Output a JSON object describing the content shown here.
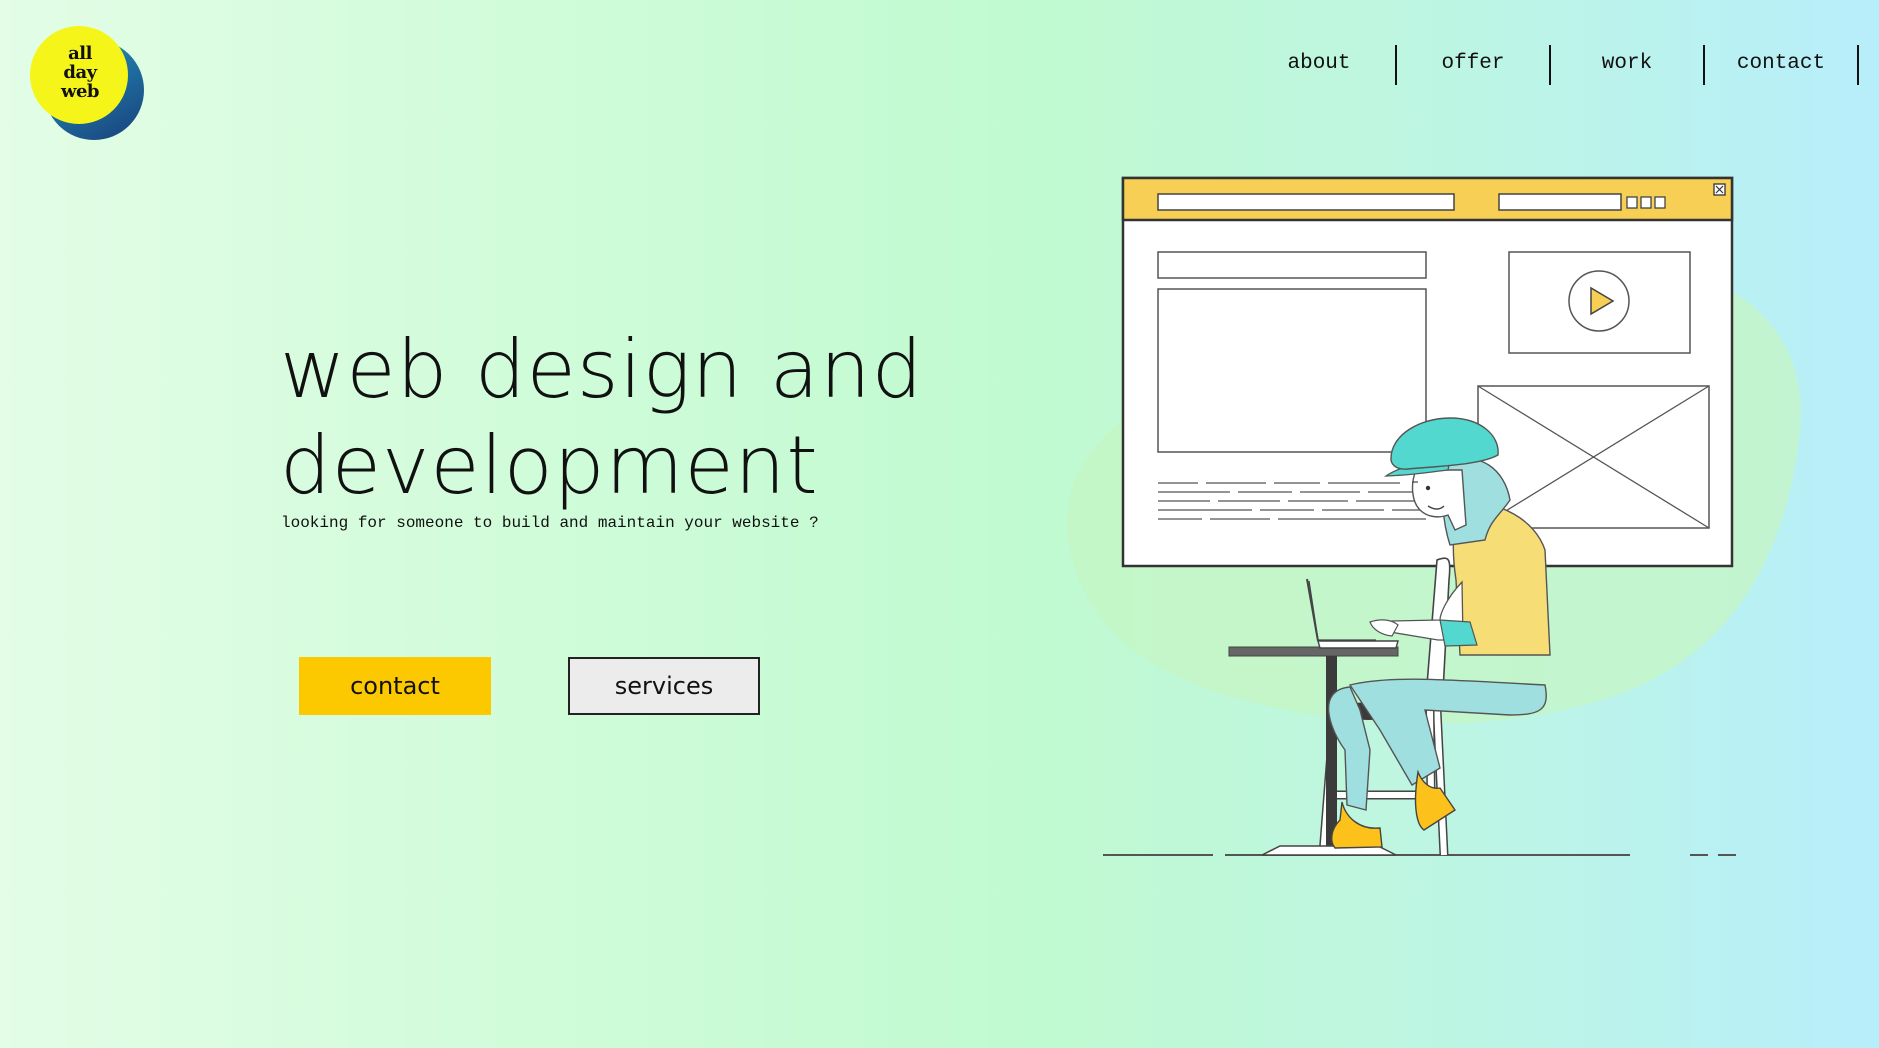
{
  "logo": {
    "line1": "all",
    "line2": "day",
    "line3": "web"
  },
  "nav": {
    "items": [
      "about",
      "offer",
      "work",
      "contact"
    ]
  },
  "hero": {
    "title_line1": "web design and",
    "title_line2": "development",
    "subtitle": "looking for someone to build and maintain your website ?"
  },
  "buttons": {
    "contact": "contact",
    "services": "services"
  },
  "colors": {
    "accent_yellow": "#fcc800",
    "logo_yellow": "#f5f51a",
    "logo_blue": "#1d6e9f",
    "illustration_teal": "#52d8cf",
    "illustration_browser_bar": "#f7cf55"
  },
  "illustration": {
    "icons": [
      "browser-window-illustration",
      "play-icon",
      "person-at-laptop-illustration",
      "close-icon"
    ]
  }
}
